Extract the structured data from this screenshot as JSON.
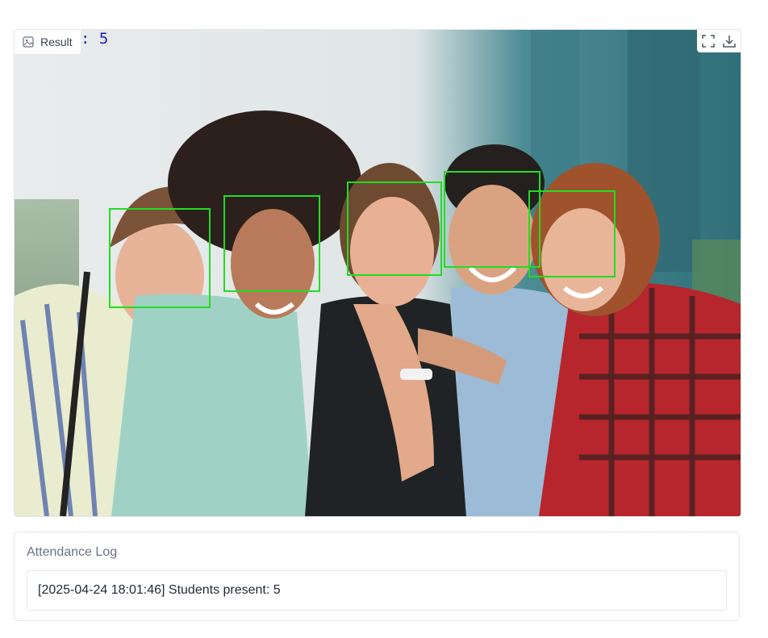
{
  "result_panel": {
    "label": "Result",
    "label_icon": "image-icon",
    "count_overlay": ": 5",
    "tools": [
      {
        "name": "fullscreen-icon"
      },
      {
        "name": "download-icon"
      }
    ],
    "photo": {
      "description_kind": "group photo of five smiling people with green face detection boxes",
      "box_color": "#22dd22",
      "faces_detected": 5
    }
  },
  "attendance": {
    "label": "Attendance Log",
    "log_text": "[2025-04-24 18:01:46] Students present: 5"
  }
}
